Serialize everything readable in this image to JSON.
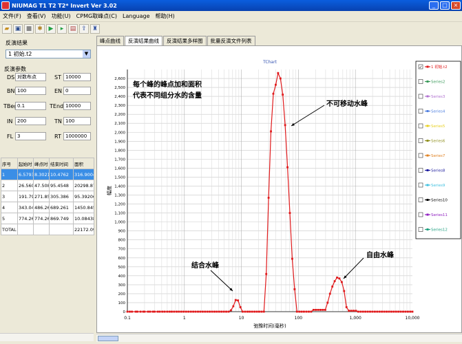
{
  "window": {
    "title": "NIUMAG T1 T2 T2* Invert Ver 3.02",
    "min": "_",
    "max": "□",
    "close": "×"
  },
  "menu": [
    "文件(F)",
    "查看(V)",
    "功能(U)",
    "CPMG取峰点(C)",
    "Language",
    "帮助(H)"
  ],
  "toolbar": [
    "open-icon",
    "save-icon",
    "stop-icon",
    "gear-icon",
    "play-icon",
    "play-forward-icon",
    "chart-icon",
    "export-icon",
    "run-icon"
  ],
  "left": {
    "result_group": "反演结果",
    "result_select": "1 初始.t2",
    "params_group": "反演参数",
    "params": [
      {
        "label": "DS",
        "value": "对数布点"
      },
      {
        "label": "ST",
        "value": "10000"
      },
      {
        "label": "BN",
        "value": "100"
      },
      {
        "label": "EN",
        "value": "0"
      },
      {
        "label": "TBeg",
        "value": "0.1"
      },
      {
        "label": "TEnd",
        "value": "10000"
      },
      {
        "label": "IN",
        "value": "200"
      },
      {
        "label": "TN",
        "value": "100"
      },
      {
        "label": "FL",
        "value": "3"
      },
      {
        "label": "RT",
        "value": "1000000"
      }
    ],
    "table": {
      "headers": [
        "序号",
        "起始时",
        "峰点时",
        "结束时间",
        "面积"
      ],
      "rows": [
        [
          "1",
          "6.57933",
          "8.30218",
          "10.4762",
          "316.90045"
        ],
        [
          "2",
          "26.5609",
          "47.5081",
          "95.4548",
          "20298.875"
        ],
        [
          "3",
          "191.791",
          "271.859",
          "305.386",
          "95.39206"
        ],
        [
          "4",
          "343.047",
          "486.26",
          "689.261",
          "1450.84504"
        ],
        [
          "5",
          "774.264",
          "774.264",
          "869.749",
          "10.08438"
        ],
        [
          "TOTAL",
          "",
          "",
          "",
          "22172.0965"
        ]
      ]
    }
  },
  "tabs": [
    "峰点曲线",
    "反演结果曲线",
    "反演结果多样图",
    "批量反演文件列表"
  ],
  "chart_data": {
    "type": "line",
    "title": "TChart",
    "xlabel": "弛豫时间(毫秒)",
    "ylabel": "幅度",
    "x_scale": "log",
    "xlim": [
      0.1,
      10000
    ],
    "ylim": [
      0,
      2700
    ],
    "x_ticks": [
      "0.1",
      "1",
      "10",
      "100",
      "1,000",
      "10,000"
    ],
    "y_ticks": [
      "0",
      "100",
      "200",
      "300",
      "400",
      "500",
      "600",
      "700",
      "800",
      "900",
      "1,000",
      "1,100",
      "1,200",
      "1,300",
      "1,400",
      "1,500",
      "1,600",
      "1,700",
      "1,800",
      "1,900",
      "2,000",
      "2,100",
      "2,200",
      "2,300",
      "2,400",
      "2,500",
      "2,600"
    ],
    "grid": true,
    "legend_position": "right",
    "series": [
      {
        "name": "1 初始.t2",
        "color": "#e0191b",
        "points": [
          [
            0.1,
            0
          ],
          [
            0.11,
            0
          ],
          [
            0.12,
            0
          ],
          [
            0.14,
            0
          ],
          [
            0.15,
            0
          ],
          [
            0.17,
            0
          ],
          [
            0.19,
            0
          ],
          [
            0.2,
            0
          ],
          [
            0.23,
            0
          ],
          [
            0.25,
            0
          ],
          [
            0.28,
            0
          ],
          [
            0.3,
            0
          ],
          [
            0.34,
            0
          ],
          [
            0.37,
            0
          ],
          [
            0.41,
            0
          ],
          [
            0.45,
            0
          ],
          [
            0.5,
            0
          ],
          [
            0.55,
            0
          ],
          [
            0.6,
            0
          ],
          [
            0.66,
            0
          ],
          [
            0.73,
            0
          ],
          [
            0.8,
            0
          ],
          [
            0.88,
            0
          ],
          [
            0.97,
            0
          ],
          [
            1.07,
            0
          ],
          [
            1.18,
            0
          ],
          [
            1.3,
            0
          ],
          [
            1.43,
            0
          ],
          [
            1.57,
            0
          ],
          [
            1.73,
            0
          ],
          [
            1.9,
            0
          ],
          [
            2.09,
            0
          ],
          [
            2.3,
            0
          ],
          [
            2.53,
            0
          ],
          [
            2.78,
            0
          ],
          [
            3.06,
            0
          ],
          [
            3.37,
            0
          ],
          [
            3.7,
            0
          ],
          [
            4.07,
            0
          ],
          [
            4.48,
            0
          ],
          [
            4.93,
            0
          ],
          [
            5.42,
            0
          ],
          [
            5.96,
            0
          ],
          [
            6.56,
            15
          ],
          [
            7.21,
            60
          ],
          [
            7.93,
            130
          ],
          [
            8.72,
            125
          ],
          [
            9.6,
            50
          ],
          [
            10.5,
            0
          ],
          [
            11.6,
            0
          ],
          [
            12.8,
            0
          ],
          [
            14.0,
            0
          ],
          [
            15.4,
            0
          ],
          [
            17.0,
            0
          ],
          [
            18.7,
            0
          ],
          [
            20.5,
            0
          ],
          [
            22.6,
            0
          ],
          [
            24.8,
            0
          ],
          [
            27.3,
            420
          ],
          [
            30.0,
            1270
          ],
          [
            33.0,
            2010
          ],
          [
            36.3,
            2430
          ],
          [
            40.0,
            2530
          ],
          [
            44.0,
            2660
          ],
          [
            48.4,
            2600
          ],
          [
            53.2,
            2420
          ],
          [
            58.5,
            2080
          ],
          [
            64.4,
            1610
          ],
          [
            70.8,
            1100
          ],
          [
            77.9,
            590
          ],
          [
            85.7,
            250
          ],
          [
            94.3,
            0
          ],
          [
            104,
            0
          ],
          [
            114,
            0
          ],
          [
            125,
            0
          ],
          [
            138,
            0
          ],
          [
            152,
            0
          ],
          [
            167,
            0
          ],
          [
            184,
            20
          ],
          [
            202,
            20
          ],
          [
            222,
            20
          ],
          [
            244,
            20
          ],
          [
            269,
            20
          ],
          [
            296,
            20
          ],
          [
            325,
            100
          ],
          [
            358,
            200
          ],
          [
            394,
            280
          ],
          [
            433,
            340
          ],
          [
            476,
            380
          ],
          [
            524,
            370
          ],
          [
            576,
            330
          ],
          [
            634,
            230
          ],
          [
            697,
            50
          ],
          [
            767,
            10
          ],
          [
            844,
            10
          ],
          [
            928,
            10
          ],
          [
            1021,
            10
          ],
          [
            1123,
            0
          ],
          [
            1236,
            0
          ],
          [
            1359,
            0
          ],
          [
            1495,
            0
          ],
          [
            1645,
            0
          ],
          [
            1809,
            0
          ],
          [
            1990,
            0
          ],
          [
            2189,
            0
          ],
          [
            2408,
            0
          ],
          [
            2649,
            0
          ],
          [
            2914,
            0
          ],
          [
            3205,
            0
          ],
          [
            3526,
            0
          ],
          [
            3878,
            0
          ],
          [
            4266,
            0
          ],
          [
            4693,
            0
          ],
          [
            5162,
            0
          ],
          [
            5679,
            0
          ],
          [
            6246,
            0
          ],
          [
            6871,
            0
          ],
          [
            7558,
            0
          ],
          [
            8314,
            0
          ],
          [
            9145,
            0
          ],
          [
            10000,
            0
          ]
        ]
      }
    ],
    "legend": [
      {
        "name": "1 初始.t2",
        "color": "#e0191b",
        "checked": true
      },
      {
        "name": "Series2",
        "color": "#3a9a5a",
        "checked": false
      },
      {
        "name": "Series3",
        "color": "#b070d0",
        "checked": false
      },
      {
        "name": "Series4",
        "color": "#5080e0",
        "checked": false
      },
      {
        "name": "Series5",
        "color": "#e8d020",
        "checked": false
      },
      {
        "name": "Series6",
        "color": "#909020",
        "checked": false
      },
      {
        "name": "Series7",
        "color": "#e08020",
        "checked": false
      },
      {
        "name": "Series8",
        "color": "#2020a0",
        "checked": false
      },
      {
        "name": "Series9",
        "color": "#40c0e0",
        "checked": false
      },
      {
        "name": "Series10",
        "color": "#000000",
        "checked": false
      },
      {
        "name": "Series11",
        "color": "#9020c0",
        "checked": false
      },
      {
        "name": "Series12",
        "color": "#20a080",
        "checked": false
      }
    ],
    "annotations": [
      {
        "text": "每个峰的峰点加和面积",
        "line": 1
      },
      {
        "text": "代表不同组分水的含量",
        "line": 2
      },
      {
        "text": "不可移动水峰"
      },
      {
        "text": "结合水峰"
      },
      {
        "text": "自由水峰"
      }
    ]
  }
}
